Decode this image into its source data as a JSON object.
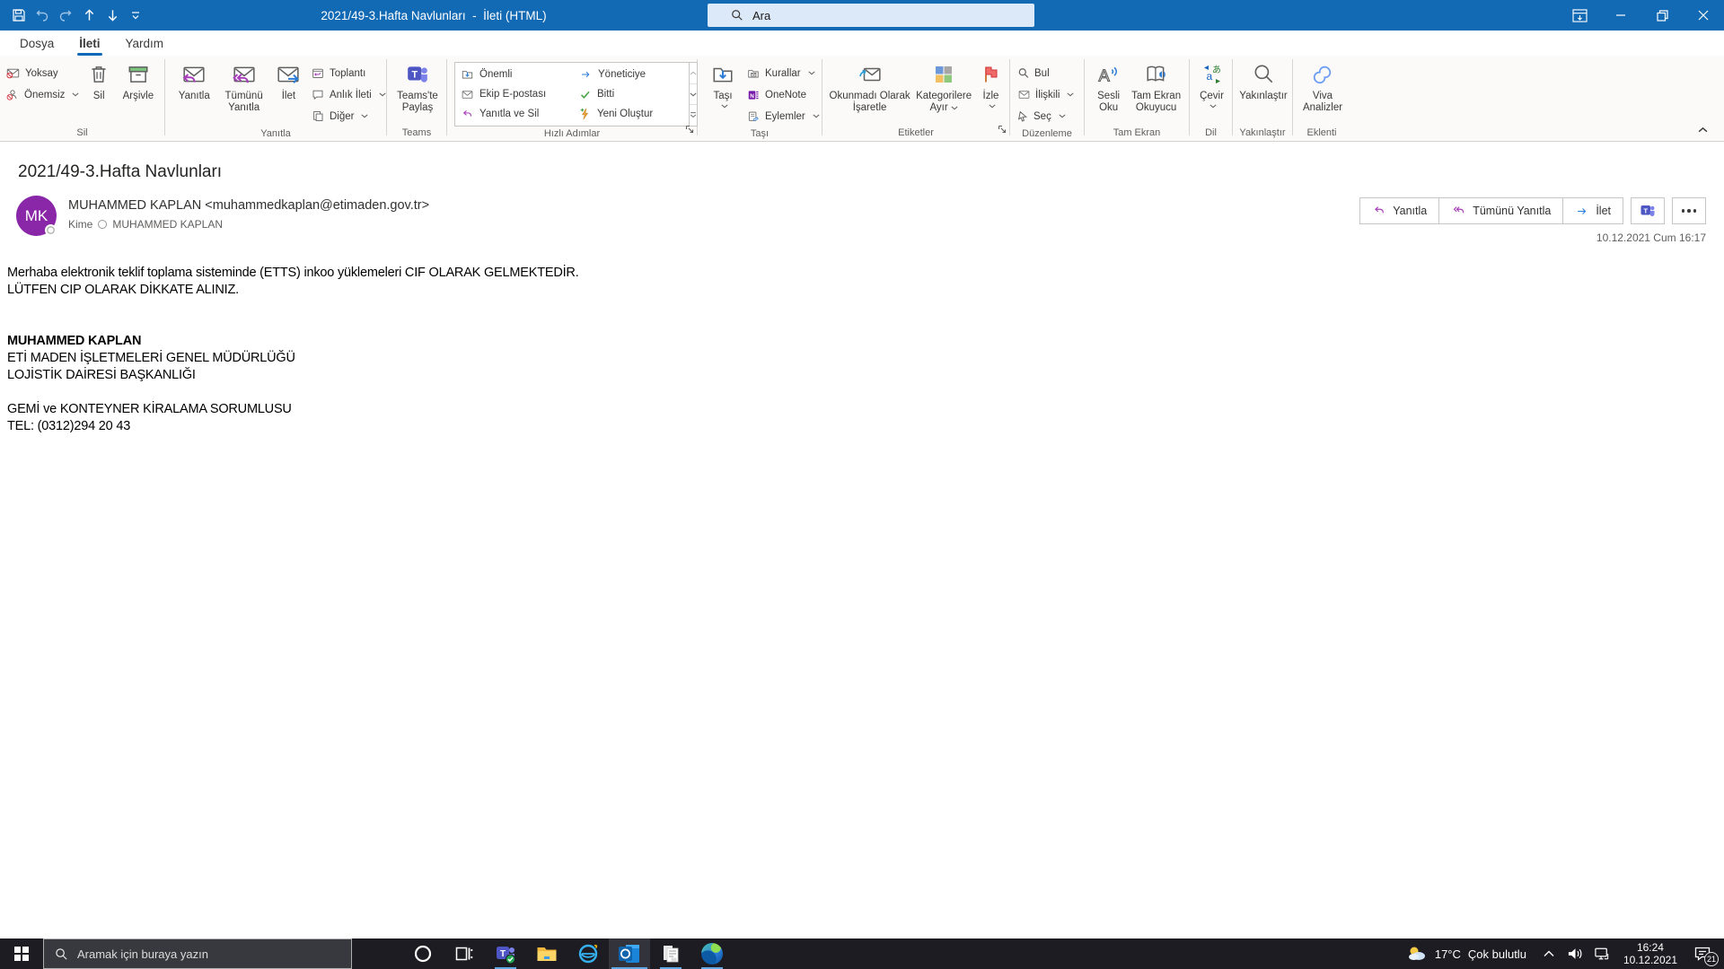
{
  "titlebar": {
    "title": "2021/49-3.Hafta Navlunları  -  İleti (HTML)",
    "search_placeholder": "Ara"
  },
  "tabs": {
    "dosya": "Dosya",
    "ileti": "İleti",
    "yardim": "Yardım"
  },
  "ribbon": {
    "sil": {
      "label": "Sil",
      "yoksay": "Yoksay",
      "onemsiz": "Önemsiz",
      "sil": "Sil",
      "arsivle": "Arşivle"
    },
    "yanitla": {
      "label": "Yanıtla",
      "yanitla": "Yanıtla",
      "tumunu": "Tümünü Yanıtla",
      "ilet": "İlet",
      "toplanti": "Toplantı",
      "anlik": "Anlık İleti",
      "diger": "Diğer"
    },
    "teams": {
      "label": "Teams",
      "paylas": "Teams'te Paylaş"
    },
    "hizli": {
      "label": "Hızlı Adımlar",
      "onemli": "Önemli",
      "ekip": "Ekip E-postası",
      "yanitla_sil": "Yanıtla ve Sil",
      "yoneticiye": "Yöneticiye",
      "bitti": "Bitti",
      "yeni": "Yeni Oluştur"
    },
    "tasi": {
      "label": "Taşı",
      "tasi": "Taşı",
      "kurallar": "Kurallar",
      "onenote": "OneNote",
      "eylemler": "Eylemler"
    },
    "etiketler": {
      "label": "Etiketler",
      "okunmadi": "Okunmadı Olarak İşaretle",
      "kategori": "Kategorilere Ayır",
      "izle": "İzle"
    },
    "duzenleme": {
      "label": "Düzenleme",
      "bul": "Bul",
      "iliskili": "İlişkili",
      "sec": "Seç"
    },
    "tamekran": {
      "label": "Tam Ekran",
      "sesli": "Sesli Oku",
      "okuyucu": "Tam Ekran Okuyucu"
    },
    "dil": {
      "label": "Dil",
      "cevir": "Çevir"
    },
    "yakinlastir": {
      "label": "Yakınlaştır",
      "btn": "Yakınlaştır"
    },
    "eklenti": {
      "label": "Eklenti",
      "viva": "Viva Analizler"
    }
  },
  "message": {
    "subject": "2021/49-3.Hafta Navlunları",
    "avatar_initials": "MK",
    "sender": "MUHAMMED KAPLAN <muhammedkaplan@etimaden.gov.tr>",
    "to_label": "Kime",
    "to_name": "MUHAMMED KAPLAN",
    "date": "10.12.2021 Cum 16:17",
    "actions": {
      "yanitla": "Yanıtla",
      "tumunu": "Tümünü Yanıtla",
      "ilet": "İlet"
    },
    "body": [
      "Merhaba elektronik teklif toplama sisteminde (ETTS) inkoo yüklemeleri CIF OLARAK GELMEKTEDİR.",
      "LÜTFEN CIP OLARAK DİKKATE ALINIZ.",
      "",
      "",
      "MUHAMMED KAPLAN",
      "ETİ MADEN İŞLETMELERİ GENEL MÜDÜRLÜĞÜ",
      "LOJİSTİK DAİRESİ BAŞKANLIĞI",
      "",
      "GEMİ ve KONTEYNER KİRALAMA SORUMLUSU",
      "TEL: (0312)294 20 43"
    ]
  },
  "taskbar": {
    "search_placeholder": "Aramak için buraya yazın",
    "weather_temp": "17°C",
    "weather_desc": "Çok bulutlu",
    "time": "16:24",
    "date": "10.12.2021",
    "badge": "21"
  },
  "colors": {
    "titlebar": "#1269b4",
    "accent": "#1168b8",
    "taskbar": "#1c1c22",
    "avatar": "#8a27a8"
  }
}
